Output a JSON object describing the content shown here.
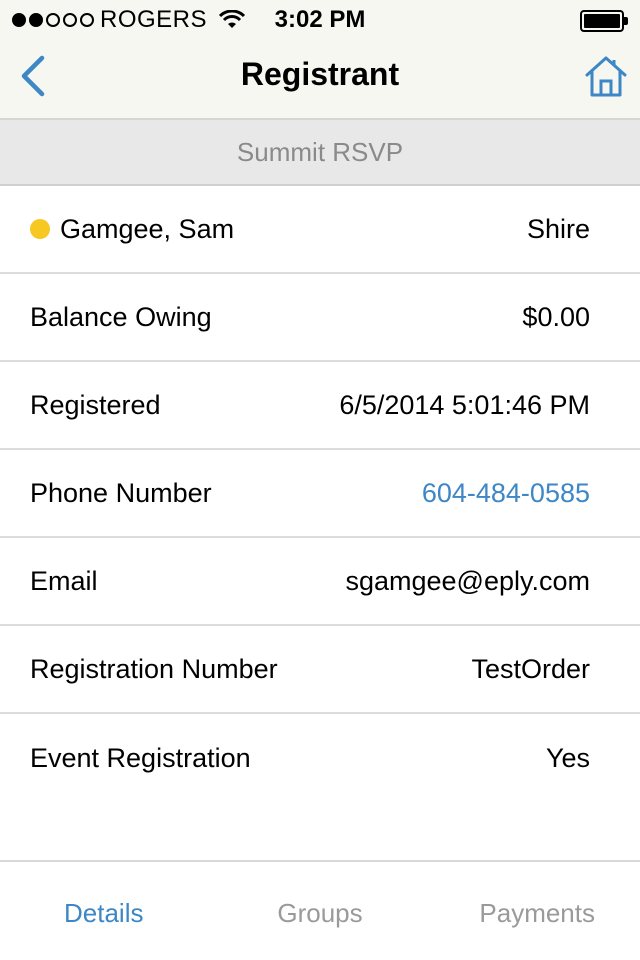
{
  "status_bar": {
    "signal_icon": "signal-dots-icon",
    "carrier": "ROGERS",
    "wifi_icon": "wifi-icon",
    "time": "3:02 PM",
    "battery_icon": "battery-icon"
  },
  "nav": {
    "title": "Registrant",
    "back_icon": "chevron-left-icon",
    "home_icon": "home-icon"
  },
  "section": {
    "title": "Summit RSVP"
  },
  "registrant": {
    "name": "Gamgee, Sam",
    "location": "Shire",
    "status_color": "#f7c821"
  },
  "rows": [
    {
      "label": "Balance Owing",
      "value": "$0.00"
    },
    {
      "label": "Registered",
      "value": "6/5/2014 5:01:46 PM"
    },
    {
      "label": "Phone Number",
      "value": "604-484-0585"
    },
    {
      "label": "Email",
      "value": "sgamgee@eply.com"
    },
    {
      "label": "Registration Number",
      "value": "TestOrder"
    },
    {
      "label": "Event Registration",
      "value": "Yes"
    }
  ],
  "tabs": [
    {
      "label": "Details",
      "active": true
    },
    {
      "label": "Groups",
      "active": false
    },
    {
      "label": "Payments",
      "active": false
    }
  ],
  "colors": {
    "accent": "#3d87c6",
    "bar_background": "#f5f7f0",
    "section_background": "#e8e8e8"
  }
}
